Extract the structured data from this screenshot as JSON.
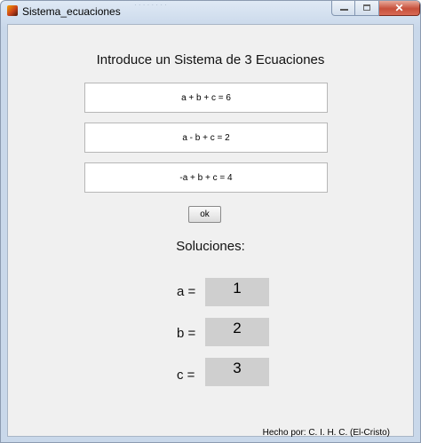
{
  "window": {
    "title": "Sistema_ecuaciones",
    "ghost_text": "· · · · · · · ·",
    "close_glyph": "✕"
  },
  "form": {
    "heading": "Introduce un Sistema de 3 Ecuaciones",
    "equations": [
      "a + b + c = 6",
      "a - b + c = 2",
      "-a + b + c = 4"
    ],
    "ok_label": "ok"
  },
  "solutions": {
    "heading": "Soluciones:",
    "items": [
      {
        "label": "a =",
        "value": "1"
      },
      {
        "label": "b =",
        "value": "2"
      },
      {
        "label": "c =",
        "value": "3"
      }
    ]
  },
  "footer": {
    "credit": "Hecho por: C. I. H. C. (El-Cristo)"
  }
}
